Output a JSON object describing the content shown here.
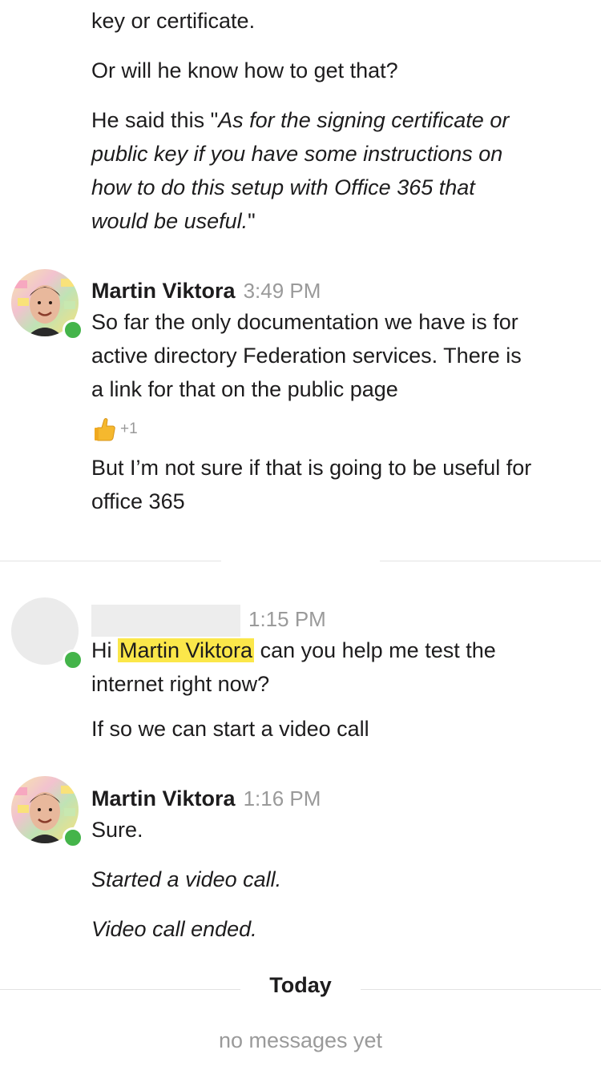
{
  "message_block_1": {
    "lines": [
      "key or certificate.",
      "Or will he know how to get that?"
    ],
    "quote_prefix": "He said this \"",
    "quote_lines": [
      "As for the signing certificate or",
      "public key if you have some instructions on",
      "how to do this setup with Office 365 that",
      "would be useful."
    ],
    "quote_suffix": "\""
  },
  "message_block_2": {
    "author": "Martin Viktora",
    "time": "3:49 PM",
    "lines": [
      "So far the only documentation we have is for",
      "active directory Federation services. There is",
      "a link for that on the public page"
    ],
    "reaction": {
      "icon": "thumbs-up-icon",
      "count": "+1"
    },
    "followup_lines": [
      "But I’m not sure if that is going to be useful for",
      "office 365"
    ]
  },
  "message_block_3": {
    "time": "1:15 PM",
    "line1_before": "Hi ",
    "mention": "Martin Viktora",
    "line1_after": " can you help me test the",
    "line2": "internet right now?",
    "line3": "If so we can start a video call"
  },
  "message_block_4": {
    "author": "Martin Viktora",
    "time": "1:16 PM",
    "line1": "Sure.",
    "line2": "Started a video call.",
    "line3": "Video call ended."
  },
  "day_divider": {
    "label": "Today"
  },
  "empty_state": {
    "text": "no messages yet"
  },
  "colors": {
    "presence": "#44b44a",
    "mention_highlight": "#fbe74a",
    "meta_gray": "#9a9a9a"
  }
}
